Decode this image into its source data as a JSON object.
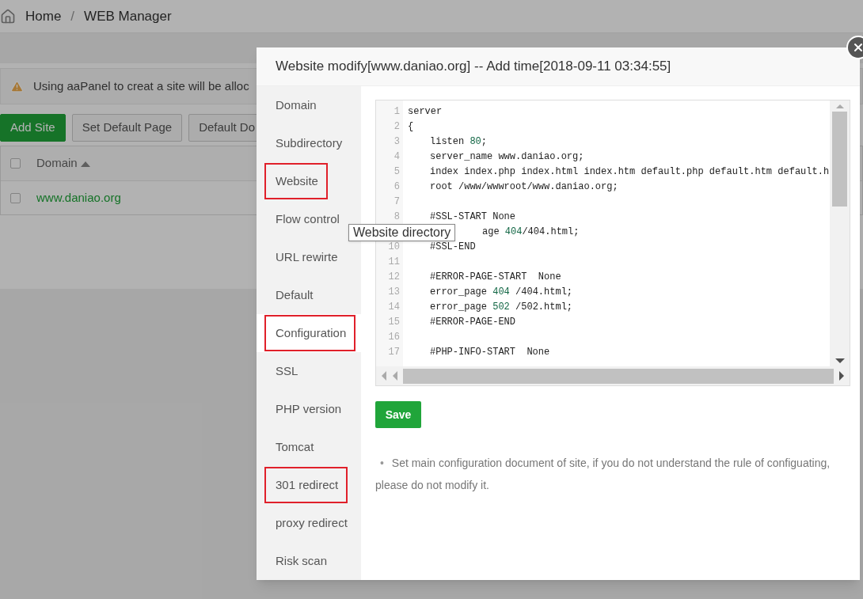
{
  "breadcrumb": {
    "items": [
      {
        "label": "Home"
      },
      {
        "label": "WEB Manager"
      }
    ],
    "separator": "/"
  },
  "notice": {
    "text": "Using aaPanel to creat a site will be alloc"
  },
  "toolbar": [
    {
      "label": "Add Site",
      "kind": "primary"
    },
    {
      "label": "Set Default Page",
      "kind": "default"
    },
    {
      "label": "Default Do",
      "kind": "default"
    }
  ],
  "table": {
    "header_checked": false,
    "columns": [
      {
        "label": "Domain",
        "sorted_ascending": true
      }
    ],
    "rows": [
      {
        "selected": false,
        "cells": [
          "www.daniao.org"
        ]
      }
    ]
  },
  "modal": {
    "title": "Website modify[www.daniao.org] -- Add time[2018-09-11 03:34:55]",
    "nav": [
      {
        "label": "Domain",
        "selected": false,
        "highlighted": false
      },
      {
        "label": "Subdirectory",
        "selected": false,
        "highlighted": false
      },
      {
        "label": "Website",
        "selected": false,
        "highlighted": true
      },
      {
        "label": "Flow control",
        "selected": false,
        "highlighted": false
      },
      {
        "label": "URL rewirte",
        "selected": false,
        "highlighted": false
      },
      {
        "label": "Default",
        "selected": false,
        "highlighted": false
      },
      {
        "label": "Configuration",
        "selected": true,
        "highlighted": true
      },
      {
        "label": "SSL",
        "selected": false,
        "highlighted": false
      },
      {
        "label": "PHP version",
        "selected": false,
        "highlighted": false
      },
      {
        "label": "Tomcat",
        "selected": false,
        "highlighted": false
      },
      {
        "label": "301 redirect",
        "selected": false,
        "highlighted": true
      },
      {
        "label": "proxy redirect",
        "selected": false,
        "highlighted": false
      },
      {
        "label": "Risk scan",
        "selected": false,
        "highlighted": false
      }
    ],
    "tooltip": "Website directory",
    "editor": {
      "lines": [
        {
          "no": "1",
          "kind": "top",
          "tokens": [
            {
              "text": "server",
              "kind": "plain"
            }
          ]
        },
        {
          "no": "2",
          "kind": "top",
          "tokens": [
            {
              "text": "{",
              "kind": "plain"
            }
          ]
        },
        {
          "no": "3",
          "kind": "indented",
          "tokens": [
            {
              "text": "listen ",
              "kind": "plain"
            },
            {
              "text": "80",
              "kind": "number"
            },
            {
              "text": ";",
              "kind": "plain"
            }
          ]
        },
        {
          "no": "4",
          "kind": "indented",
          "tokens": [
            {
              "text": "server_name www.daniao.org;",
              "kind": "plain"
            }
          ]
        },
        {
          "no": "5",
          "kind": "indented",
          "tokens": [
            {
              "text": "index index.php index.html index.htm default.php default.htm default.h",
              "kind": "plain"
            }
          ]
        },
        {
          "no": "6",
          "kind": "indented",
          "tokens": [
            {
              "text": "root /www/wwwroot/www.daniao.org;",
              "kind": "plain"
            }
          ]
        },
        {
          "no": "7"
        },
        {
          "no": "8",
          "kind": "indented",
          "tokens": [
            {
              "text": "#SSL-START None",
              "kind": "plain"
            }
          ]
        },
        {
          "kind": "covered",
          "tokens": [
            {
              "text": "age ",
              "kind": "plain"
            },
            {
              "text": "404",
              "kind": "number"
            },
            {
              "text": "/404.html;",
              "kind": "plain"
            }
          ]
        },
        {
          "no": "10",
          "kind": "indented",
          "tokens": [
            {
              "text": "#SSL-END",
              "kind": "plain"
            }
          ]
        },
        {
          "no": "11"
        },
        {
          "no": "12",
          "kind": "indented",
          "tokens": [
            {
              "text": "#ERROR-PAGE-START  None",
              "kind": "plain"
            }
          ]
        },
        {
          "no": "13",
          "kind": "indented",
          "tokens": [
            {
              "text": "error_page ",
              "kind": "plain"
            },
            {
              "text": "404",
              "kind": "number"
            },
            {
              "text": " /404.html;",
              "kind": "plain"
            }
          ]
        },
        {
          "no": "14",
          "kind": "indented",
          "tokens": [
            {
              "text": "error_page ",
              "kind": "plain"
            },
            {
              "text": "502",
              "kind": "number"
            },
            {
              "text": " /502.html;",
              "kind": "plain"
            }
          ]
        },
        {
          "no": "15",
          "kind": "indented",
          "tokens": [
            {
              "text": "#ERROR-PAGE-END",
              "kind": "plain"
            }
          ]
        },
        {
          "no": "16"
        },
        {
          "no": "17",
          "kind": "indented",
          "tokens": [
            {
              "text": "#PHP-INFO-START  None",
              "kind": "plain"
            }
          ]
        }
      ]
    },
    "save": "Save",
    "note": {
      "bullet": "•",
      "text": "Set main configuration document of site, if you do not understand the rule of configuating, please do not modify it."
    }
  }
}
